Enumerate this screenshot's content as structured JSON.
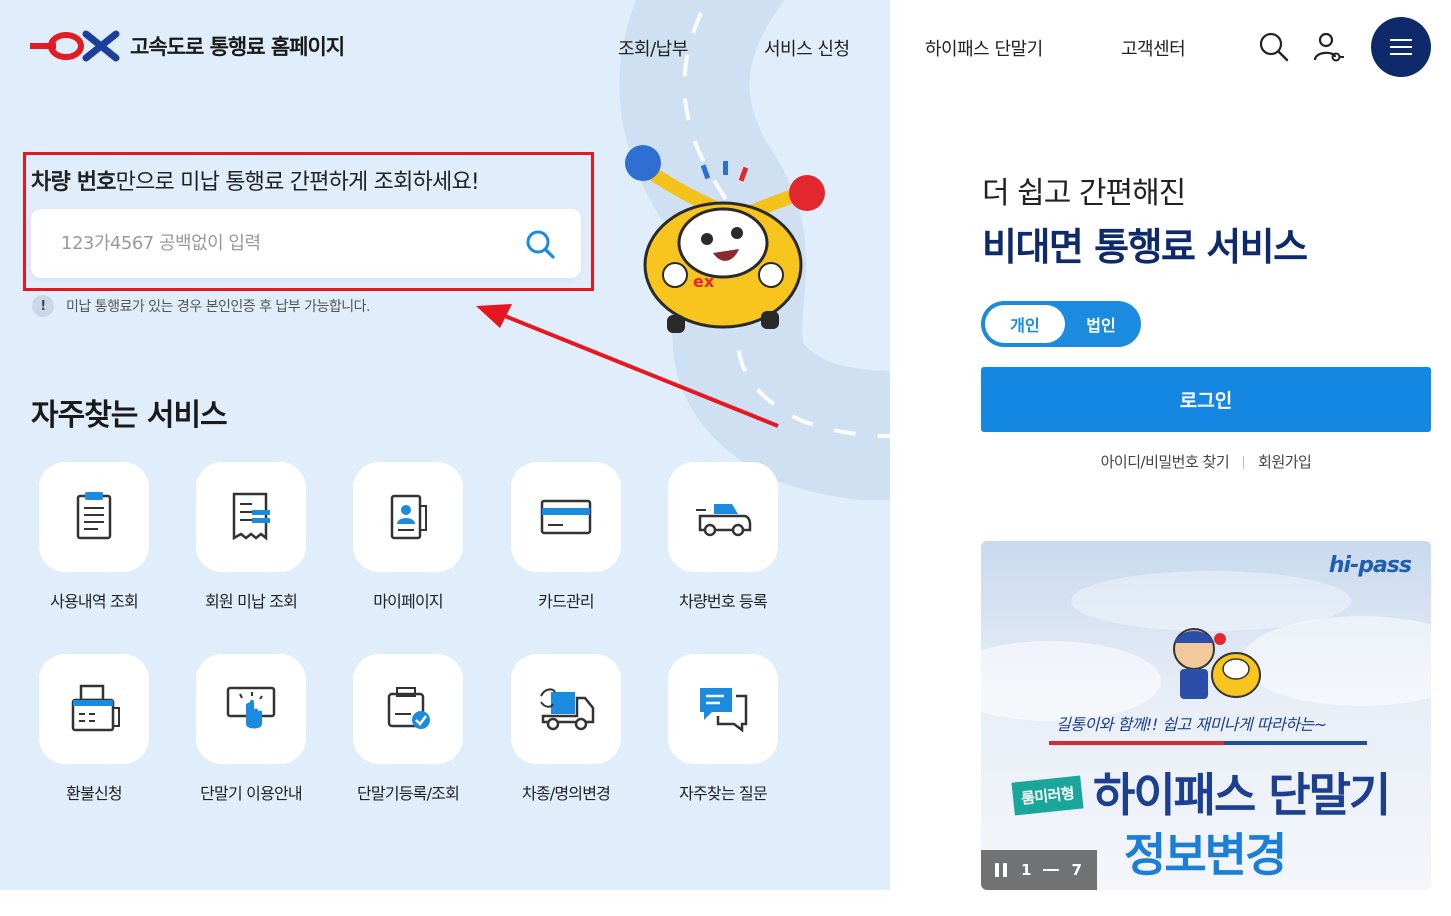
{
  "header": {
    "logo_mark": "ex",
    "logo_text": "고속도로 통행료 홈페이지",
    "nav": [
      {
        "label": "조회/납부"
      },
      {
        "label": "서비스 신청"
      },
      {
        "label": "하이패스 단말기"
      },
      {
        "label": "고객센터"
      }
    ],
    "icons": [
      "search-icon",
      "user-key-icon",
      "menu-icon"
    ]
  },
  "search": {
    "headline_bold": "차량 번호",
    "headline_rest": "만으로 미납 통행료 간편하게 조회하세요!",
    "placeholder": "123가4567 공백없이 입력",
    "value": "",
    "notice_icon": "!",
    "notice": "미납 통행료가 있는 경우 본인인증 후 납부 가능합니다."
  },
  "services": {
    "title": "자주찾는 서비스",
    "items": [
      {
        "label": "사용내역 조회",
        "icon": "document-list-icon"
      },
      {
        "label": "회원 미납 조회",
        "icon": "receipt-icon"
      },
      {
        "label": "마이페이지",
        "icon": "profile-book-icon"
      },
      {
        "label": "카드관리",
        "icon": "card-icon"
      },
      {
        "label": "차량번호 등록",
        "icon": "car-icon"
      },
      {
        "label": "환불신청",
        "icon": "fax-icon"
      },
      {
        "label": "단말기 이용안내",
        "icon": "touch-screen-icon"
      },
      {
        "label": "단말기등록/조회",
        "icon": "device-check-icon"
      },
      {
        "label": "차종/명의변경",
        "icon": "truck-change-icon"
      },
      {
        "label": "자주찾는 질문",
        "icon": "chat-icon"
      }
    ]
  },
  "right_panel": {
    "subtitle": "더 쉽고 간편해진",
    "title": "비대면 통행료 서비스",
    "toggle": {
      "active": "개인",
      "inactive": "법인"
    },
    "login_label": "로그인",
    "links": [
      "아이디/비밀번호 찾기",
      "회원가입"
    ]
  },
  "banner": {
    "brand": "hi-pass",
    "tagline": "길통이와 함께!! 쉽고 재미나게 따라하는~",
    "badge": "룸미러형",
    "headline1": "하이패스 단말기",
    "headline2": "정보변경",
    "current": "1",
    "total": "7"
  },
  "colors": {
    "accent": "#1487e2",
    "navy": "#0e2a6b",
    "hero_bg": "#e0eefb",
    "highlight": "#e8171f"
  }
}
